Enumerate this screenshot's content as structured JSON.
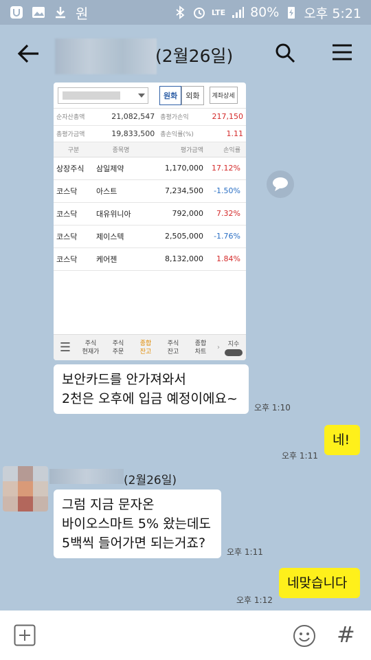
{
  "status_bar": {
    "app_glyph": "원",
    "battery_percent": "80%",
    "network": "LTE",
    "time": "오후 5:21"
  },
  "header": {
    "room_date": "(2월26일)"
  },
  "shared_image": {
    "tabs_currency": [
      "원화",
      "외화"
    ],
    "detail_button": "계좌상세",
    "summary": [
      {
        "label": "순자산총액",
        "value": "21,082,547",
        "label2": "총평가손익",
        "value2": "217,150"
      },
      {
        "label": "총평가금액",
        "value": "19,833,500",
        "label2": "총손익률(%)",
        "value2": "1.11"
      }
    ],
    "columns": [
      "구분",
      "종목명",
      "평가금액",
      "손익률"
    ],
    "holdings": [
      {
        "market": "상장주식",
        "name": "삼일제약",
        "amount": "1,170,000",
        "rate": "17.12%",
        "dir": "pos"
      },
      {
        "market": "코스닥",
        "name": "아스트",
        "amount": "7,234,500",
        "rate": "-1.50%",
        "dir": "neg"
      },
      {
        "market": "코스닥",
        "name": "대유위니아",
        "amount": "792,000",
        "rate": "7.32%",
        "dir": "pos"
      },
      {
        "market": "코스닥",
        "name": "제이스텍",
        "amount": "2,505,000",
        "rate": "-1.76%",
        "dir": "neg"
      },
      {
        "market": "코스닥",
        "name": "케어젠",
        "amount": "8,132,000",
        "rate": "1.84%",
        "dir": "pos"
      }
    ],
    "bottom_tabs": [
      {
        "l1": "주식",
        "l2": "현재가"
      },
      {
        "l1": "주식",
        "l2": "주문"
      },
      {
        "l1": "종합",
        "l2": "잔고"
      },
      {
        "l1": "주식",
        "l2": "잔고"
      },
      {
        "l1": "종합",
        "l2": "차트"
      }
    ],
    "index_label": "지수"
  },
  "messages": {
    "m1_line1": "보안카드를 안가져와서",
    "m1_line2": "2천은 오후에 입금 예정이에요~",
    "m1_time": "오후 1:10",
    "m2": "네!",
    "m2_time": "오후 1:11",
    "sender_date": "(2월26일)",
    "m3_line1": "그럼 지금 문자온",
    "m3_line2": "바이오스마트 5% 왔는데도",
    "m3_line3": "5백씩 들어가면 되는거죠?",
    "m3_time": "오후 1:11",
    "m4": "네맞습니다",
    "m4_time": "오후 1:12"
  },
  "colors": {
    "chat_bg": "#b2c7da",
    "my_bubble": "#fef01b",
    "gain": "#d42a2a",
    "loss": "#2a6fc4"
  }
}
